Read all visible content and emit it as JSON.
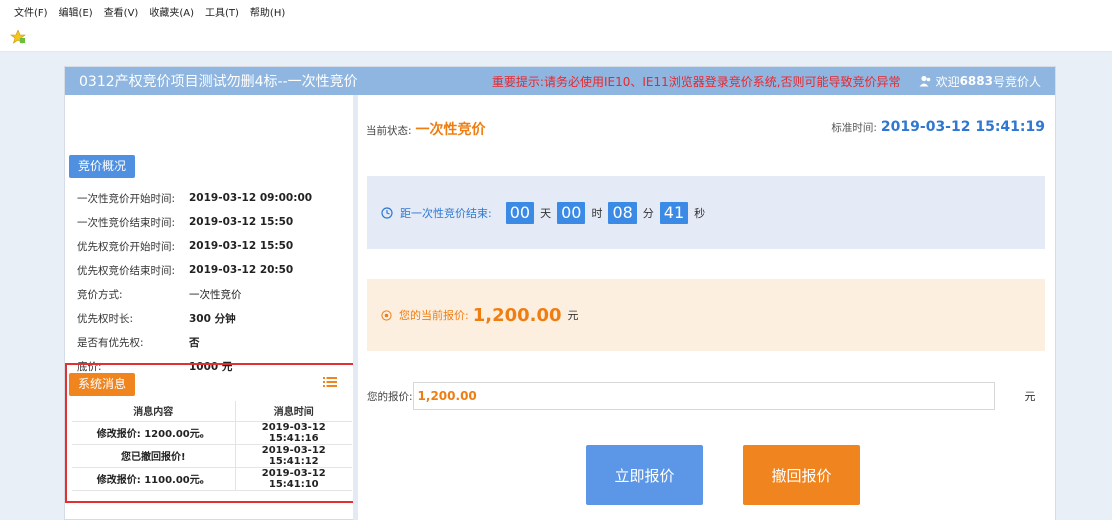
{
  "menu": [
    "文件(F)",
    "编辑(E)",
    "查看(V)",
    "收藏夹(A)",
    "工具(T)",
    "帮助(H)"
  ],
  "header": {
    "title": "0312产权竞价项目测试勿删4标--一次性竞价",
    "notice": "重要提示:请务必使用IE10、IE11浏览器登录竞价系统,否则可能导致竞价异常",
    "welcome_prefix": "欢迎",
    "bidder_number": "6883",
    "welcome_suffix": "号竞价人"
  },
  "overview": {
    "button": "竞价概况",
    "rows": [
      {
        "key": "一次性竞价开始时间:",
        "value": "2019-03-12 09:00:00"
      },
      {
        "key": "一次性竞价结束时间:",
        "value": "2019-03-12 15:50"
      },
      {
        "key": "优先权竞价开始时间:",
        "value": "2019-03-12 15:50"
      },
      {
        "key": "优先权竞价结束时间:",
        "value": "2019-03-12 20:50"
      },
      {
        "key": "竞价方式:",
        "value": "一次性竞价"
      },
      {
        "key": "优先权时长:",
        "value": "300 分钟"
      },
      {
        "key": "是否有优先权:",
        "value": "否"
      },
      {
        "key": "底价:",
        "value": "1000 元"
      }
    ]
  },
  "messages": {
    "button": "系统消息",
    "columns": [
      "消息内容",
      "消息时间"
    ],
    "rows": [
      [
        "修改报价: 1200.00元。",
        "2019-03-12 15:41:16"
      ],
      [
        "您已撤回报价!",
        "2019-03-12 15:41:12"
      ],
      [
        "修改报价: 1100.00元。",
        "2019-03-12 15:41:10"
      ]
    ]
  },
  "status": {
    "label": "当前状态:",
    "value": "一次性竞价",
    "time_label": "标准时间:",
    "time_value": "2019-03-12 15:41:19"
  },
  "countdown": {
    "label": "距一次性竞价结束:",
    "days": "00",
    "days_unit": "天",
    "hours": "00",
    "hours_unit": "时",
    "minutes": "08",
    "minutes_unit": "分",
    "seconds": "41",
    "seconds_unit": "秒"
  },
  "current_bid": {
    "label": "您的当前报价:",
    "amount": "1,200.00",
    "unit": "元"
  },
  "bid_form": {
    "label": "您的报价:",
    "value": "1,200.00",
    "unit": "元"
  },
  "actions": {
    "submit": "立即报价",
    "withdraw": "撤回报价"
  },
  "colors": {
    "header_bg": "#8fb6e0",
    "notice": "#e8272f",
    "accent_blue": "#2f77d0",
    "accent_orange": "#ef7e12",
    "highlight_border": "#e22f2f"
  },
  "icons": [
    "favorites-star-icon",
    "user-icon",
    "list-icon",
    "clock-icon",
    "dot-icon"
  ]
}
